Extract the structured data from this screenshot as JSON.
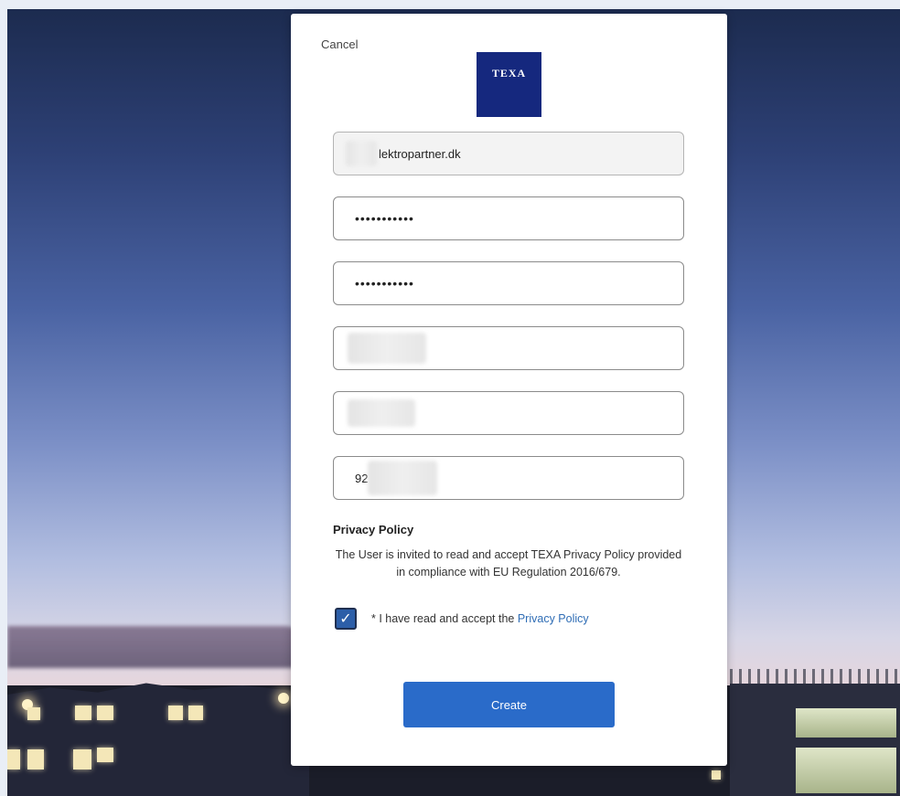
{
  "form": {
    "cancel_label": "Cancel",
    "logo_text": "TEXA",
    "email_value": "lektropartner.dk",
    "password_mask": "•••••••••••",
    "confirm_password_mask": "•••••••••••",
    "phone_prefix": "92"
  },
  "privacy": {
    "title": "Privacy Policy",
    "text": "The User is invited to read and accept TEXA Privacy Policy provided in compliance with EU Regulation 2016/679.",
    "consent_prefix": "* I have read and accept the ",
    "consent_link": "Privacy Policy",
    "checkbox_checked": true
  },
  "actions": {
    "create_label": "Create"
  },
  "colors": {
    "brand_logo": "#15287e",
    "primary_button": "#2a6bc9",
    "link": "#2f6db5"
  }
}
